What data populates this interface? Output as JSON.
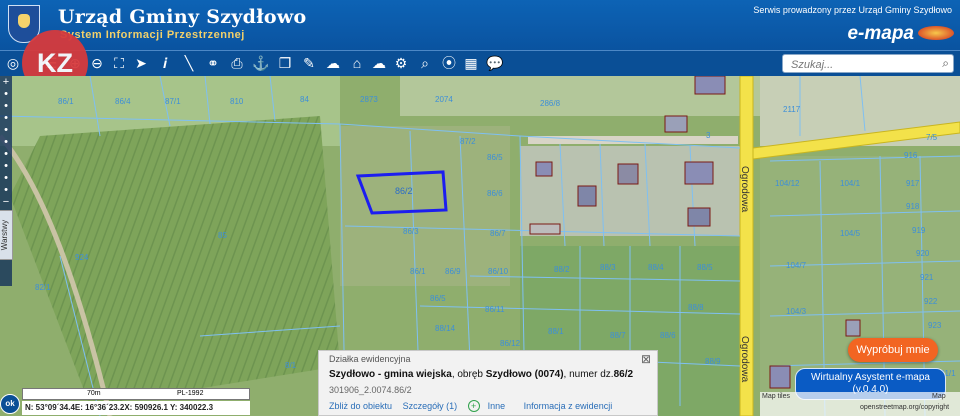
{
  "header": {
    "title": "Urząd Gminy Szydłowo",
    "subtitle": "System Informacji Przestrzennej",
    "service_text": "Serwis prowadzony przez Urząd Gminy Szydłowo",
    "brand": "e-mapa"
  },
  "watermark": {
    "label": "KZ"
  },
  "search": {
    "placeholder": "Szukaj..."
  },
  "toolbar": {
    "icons": [
      "globe-icon",
      "layers-icon",
      "zoom-in-icon",
      "zoom-out-icon",
      "zoom-extent-icon",
      "zoom-box-icon",
      "pointer-icon",
      "info-icon",
      "measure-distance-icon",
      "measure-link-icon",
      "print-icon",
      "anchor-icon",
      "copy-icon",
      "edit-icon",
      "comment-icon",
      "cloud-icon",
      "cloud-download-icon",
      "settings-icon",
      "search-map-icon",
      "marker-icon",
      "legend-icon",
      "chat-icon"
    ]
  },
  "left_panel": {
    "layers_label": "Warstwy"
  },
  "map": {
    "road_label": "Ogrodowa",
    "parcels": [
      "86/1",
      "86/4",
      "87/1",
      "810",
      "2873",
      "2074",
      "286/8",
      "86/2",
      "86/3",
      "85",
      "87/2",
      "84",
      "86/5",
      "86/6",
      "86/7",
      "86/9",
      "86/10",
      "86/11",
      "86/12",
      "88/2",
      "88/3",
      "88/4",
      "88/5",
      "88/1",
      "88/7",
      "88/6",
      "88/8",
      "88/9",
      "88/14",
      "86/1",
      "86/5",
      "2117",
      "104/1",
      "104/3",
      "104/12",
      "104/7",
      "104/5",
      "916",
      "917",
      "918",
      "919",
      "920",
      "921",
      "922",
      "923",
      "924",
      "8/1",
      "82/1",
      "81/1",
      "7/5",
      "2104",
      "3",
      "284"
    ],
    "highlighted_parcel": "86/2"
  },
  "popup": {
    "title": "Działka ewidencyjna",
    "municipality": "Szydłowo - gmina wiejska",
    "district_prefix": ", obręb ",
    "district": "Szydłowo (0074)",
    "number_prefix": ", numer dz.",
    "number": "86/2",
    "id": "301906_2.0074.86/2",
    "links": {
      "zoom": "Zbliż do obiektu",
      "details": "Szczegóły (1)",
      "other": "Inne",
      "info": "Informacja z ewidencji"
    }
  },
  "buttons": {
    "try": "Wypróbuj mnie",
    "assistant_line1": "Wirtualny Asystent e-mapa",
    "assistant_line2": "(v.0.4.0)"
  },
  "status": {
    "ok": "ok",
    "scale": "70m",
    "crs": "PL-1992",
    "coords": "N: 53°09´34.4E: 16°36´23.2X: 590926.1 Y: 340022.3",
    "attribution_1": "Map tiles",
    "attribution_2": "Map",
    "attribution_3": "openstreetmap.org/copyright"
  },
  "colors": {
    "header_bg": "#0d63b5",
    "road": "#f3e24a",
    "highlight": "#1c1ef0",
    "parcel_line": "#7fc0f2",
    "try_btn": "#f26522",
    "assistant_btn": "#0a5bc4"
  }
}
